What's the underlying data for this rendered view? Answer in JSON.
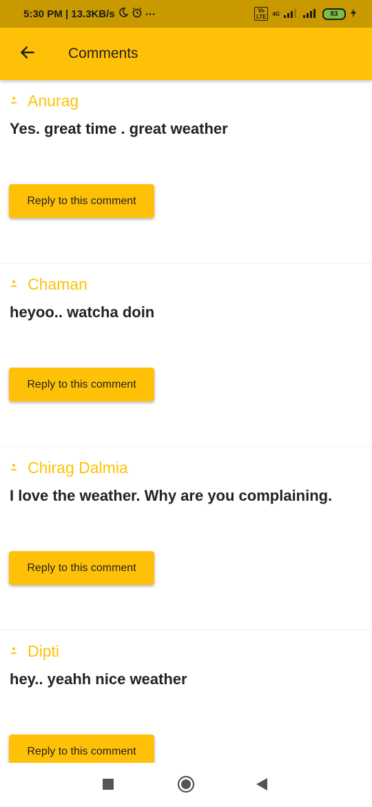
{
  "status": {
    "time_speed": "5:30 PM | 13.3KB/s",
    "network": "4G",
    "volte": "Vo LTE",
    "battery": "83"
  },
  "app_bar": {
    "title": "Comments"
  },
  "comments": [
    {
      "author": "Anurag",
      "text": "Yes. great time . great weather",
      "reply_label": "Reply to this comment"
    },
    {
      "author": "Chaman",
      "text": "heyoo.. watcha doin",
      "reply_label": "Reply to this comment"
    },
    {
      "author": "Chirag Dalmia",
      "text": "I love the weather. Why are you complaining.",
      "reply_label": "Reply to this comment"
    },
    {
      "author": "Dipti",
      "text": "hey.. yeahh nice weather",
      "reply_label": "Reply to this comment"
    }
  ],
  "colors": {
    "accent": "#ffc107",
    "status_bar": "#c99a00"
  }
}
